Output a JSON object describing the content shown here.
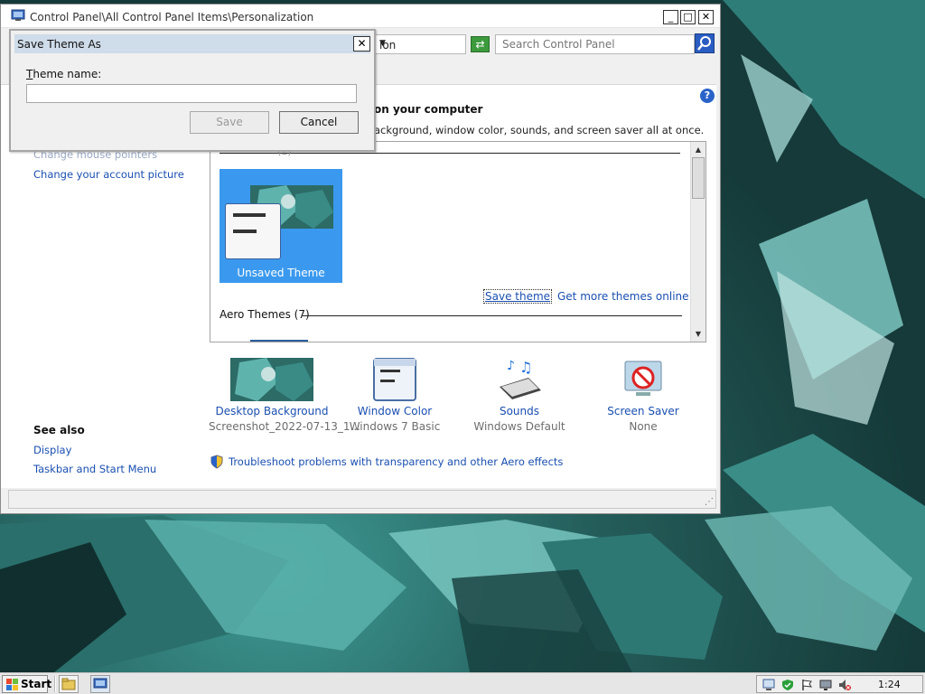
{
  "window": {
    "title": "Control Panel\\All Control Panel Items\\Personalization",
    "minimize": "_",
    "maximize": "□",
    "close": "✕"
  },
  "address": {
    "crumb_partial": "ion",
    "search_placeholder": "Search Control Panel"
  },
  "dialog": {
    "title": "Save Theme As",
    "field_label_accel": "T",
    "field_label_rest": "heme name:",
    "input_value": "",
    "save_label": "Save",
    "cancel_label": "Cancel",
    "close": "✕"
  },
  "main": {
    "heading_partial": "on your computer",
    "subtitle_partial": "ackground, window color, sounds, and screen saver all at once."
  },
  "left_pane": {
    "partial_link": "Change mouse pointers",
    "account_picture_link": "Change your account picture",
    "see_also_heading": "See also",
    "see_also_links": [
      "Display",
      "Taskbar and Start Menu"
    ]
  },
  "themes": {
    "my_themes_partial": "(1)",
    "unsaved_theme_label": "Unsaved Theme",
    "save_theme_link": "Save theme",
    "get_more_link": "Get more themes online",
    "aero_themes_label": "Aero Themes (7)"
  },
  "settings": [
    {
      "name": "Desktop Background",
      "value": "Screenshot_2022-07-13_1...",
      "icon": "desktop-background-icon"
    },
    {
      "name": "Window Color",
      "value": "Windows 7 Basic",
      "icon": "window-color-icon"
    },
    {
      "name": "Sounds",
      "value": "Windows Default",
      "icon": "sounds-icon"
    },
    {
      "name": "Screen Saver",
      "value": "None",
      "icon": "screen-saver-icon"
    }
  ],
  "troubleshoot_link": "Troubleshoot problems with transparency and other Aero effects",
  "taskbar": {
    "start_label": "Start",
    "clock": "1:24"
  },
  "colors": {
    "link": "#1a4fb0",
    "selection_tile": "#3a99ee",
    "dialog_title": "#cfdce9"
  }
}
